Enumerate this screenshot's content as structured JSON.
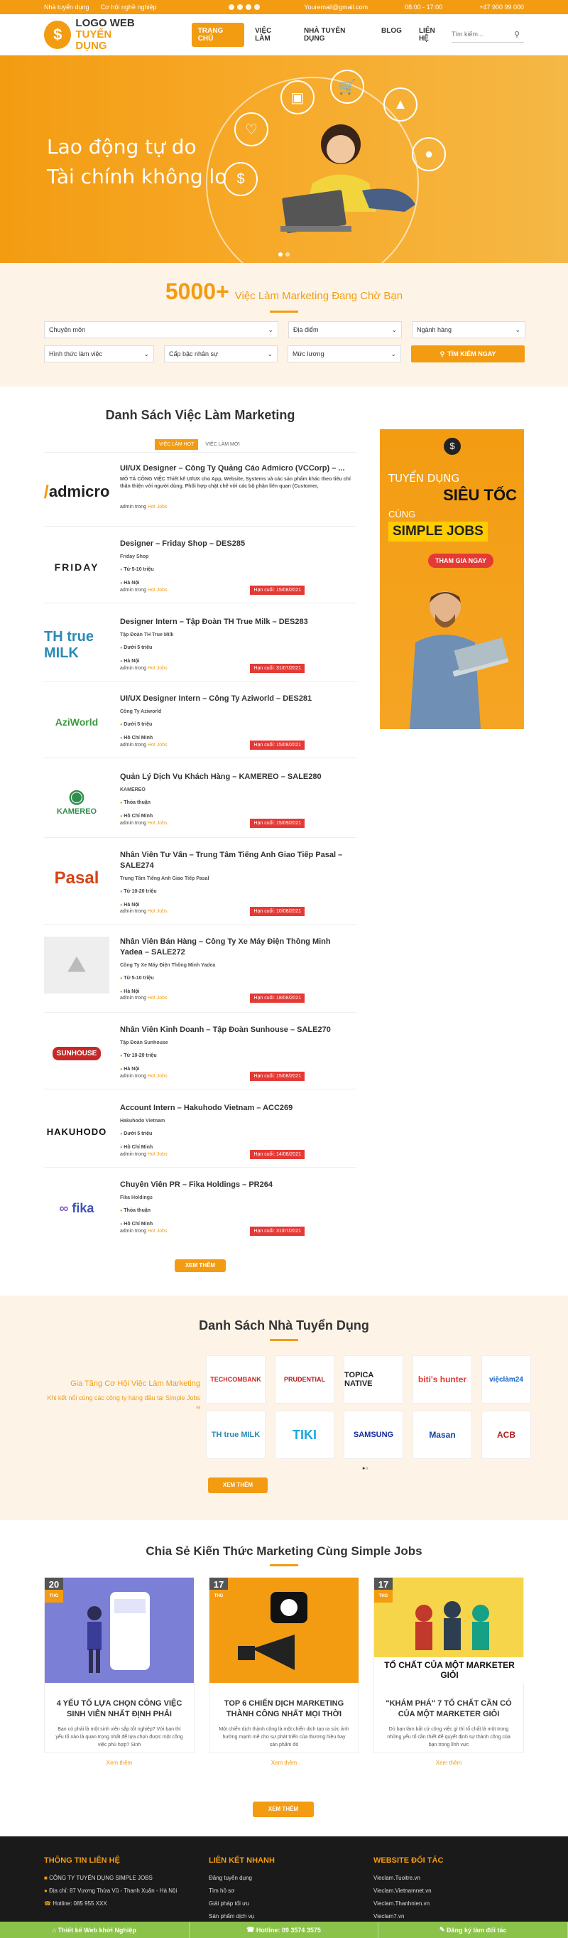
{
  "topbar": {
    "link1": "Nhà tuyển dụng",
    "link2": "Cơ hội nghề nghiệp",
    "email": "Youremail@gmail.com",
    "hours": "08:00 - 17:00",
    "phone": "+47 900 99 000"
  },
  "header": {
    "logo_line1": "LOGO WEB",
    "logo_line2": "TUYỂN DỤNG",
    "nav": [
      "TRANG CHỦ",
      "VIỆC LÀM",
      "NHÀ TUYỂN DỤNG",
      "BLOG",
      "LIÊN HỆ"
    ],
    "search_placeholder": "Tìm kiếm..."
  },
  "hero": {
    "line1": "Lao động tự do",
    "line2": "Tài chính không lo"
  },
  "search": {
    "count": "5000+",
    "headline": "Việc Làm Marketing Đang Chờ Bạn",
    "f1": "Chuyên môn",
    "f2": "Địa điểm",
    "f3": "Ngành hàng",
    "f4": "Hình thức làm việc",
    "f5": "Cấp bậc nhân sự",
    "f6": "Mức lương",
    "button": "TÌM KIẾM NGAY"
  },
  "jobs": {
    "title": "Danh Sách Việc Làm Marketing",
    "tab_hot": "VIỆC LÀM HOT",
    "tab_new": "VIỆC LÀM MỚI",
    "by": "admin",
    "in": "trong",
    "cat": "Hot Jobs",
    "more": "XEM THÊM",
    "items": [
      {
        "logo": "admicro",
        "title": "UI/UX Designer – Công Ty Quảng Cáo Admicro (VCCorp) – ...",
        "desc": "MÔ TẢ CÔNG VIỆC Thiết kế UI/UX cho App, Website, Systems và các sản phẩm khác theo tiêu chí thân thiện với người dùng. Phối hợp chặt chẽ với các bộ phận liên quan (Customer,",
        "deadline": ""
      },
      {
        "logo": "FRIDAY",
        "title": "Designer – Friday Shop – DES285",
        "company": "Friday Shop",
        "salary": "Từ 5-10 triệu",
        "place": "Hà Nội",
        "deadline": "Hạn cuối: 15/08/2021"
      },
      {
        "logo": "TH true MILK",
        "title": "Designer Intern – Tập Đoàn TH True Milk – DES283",
        "company": "Tập Đoàn TH True Milk",
        "salary": "Dưới 5 triệu",
        "place": "Hà Nội",
        "deadline": "Hạn cuối: 31/07/2021"
      },
      {
        "logo": "AziWorld",
        "title": "UI/UX Designer Intern – Công Ty Aziworld – DES281",
        "company": "Công Ty Aziworld",
        "salary": "Dưới 5 triệu",
        "place": "Hồ Chí Minh",
        "deadline": "Hạn cuối: 15/08/2021"
      },
      {
        "logo": "KAMEREO",
        "title": "Quản Lý Dịch Vụ Khách Hàng – KAMEREO – SALE280",
        "company": "KAMEREO",
        "salary": "Thỏa thuận",
        "place": "Hồ Chí Minh",
        "deadline": "Hạn cuối: 15/09/2021"
      },
      {
        "logo": "Pasal",
        "title": "Nhân Viên Tư Vấn – Trung Tâm Tiếng Anh Giao Tiếp Pasal – SALE274",
        "company": "Trung Tâm Tiếng Anh Giao Tiếp Pasal",
        "salary": "Từ 10-20 triệu",
        "place": "Hà Nội",
        "deadline": "Hạn cuối: 10/08/2021"
      },
      {
        "logo": "",
        "title": "Nhân Viên Bán Hàng – Công Ty Xe Máy Điện Thông Minh Yadea – SALE272",
        "company": "Công Ty Xe Máy Điện Thông Minh Yadea",
        "salary": "Từ 5-10 triệu",
        "place": "Hà Nội",
        "deadline": "Hạn cuối: 18/08/2021"
      },
      {
        "logo": "SUNHOUSE",
        "title": "Nhân Viên Kinh Doanh – Tập Đoàn Sunhouse – SALE270",
        "company": "Tập Đoàn Sunhouse",
        "salary": "Từ 10-20 triệu",
        "place": "Hà Nội",
        "deadline": "Hạn cuối: 15/08/2021"
      },
      {
        "logo": "HAKUHODO",
        "title": "Account Intern – Hakuhodo Vietnam – ACC269",
        "company": "Hakuhodo Vietnam",
        "salary": "Dưới 5 triệu",
        "place": "Hồ Chí Minh",
        "deadline": "Hạn cuối: 14/08/2021"
      },
      {
        "logo": "fika",
        "title": "Chuyên Viên PR – Fika Holdings – PR264",
        "company": "Fika Holdings",
        "salary": "Thỏa thuận",
        "place": "Hồ Chí Minh",
        "deadline": "Hạn cuối: 31/07/2021"
      }
    ]
  },
  "ad": {
    "l1": "TUYỂN DỤNG",
    "l2": "SIÊU TỐC",
    "l3": "CÙNG",
    "l4": "SIMPLE JOBS",
    "cta": "THAM GIA NGAY"
  },
  "employers": {
    "title": "Danh Sách Nhà Tuyển Dụng",
    "left1": "Gia Tăng Cơ Hội Việc Làm Marketing",
    "left2": "Khi kết nối cùng các công ty hàng đầu tại Simple Jobs",
    "logos": [
      "TECHCOMBANK",
      "PRUDENTIAL",
      "TOPICA NATIVE",
      "biti's hunter",
      "việclàm24",
      "TH true MILK",
      "TIKI",
      "SAMSUNG",
      "Masan",
      "ACB"
    ],
    "more": "XEM THÊM"
  },
  "blog": {
    "title": "Chia Sẻ Kiến Thức Marketing Cùng Simple Jobs",
    "more": "XEM THÊM",
    "readmore": "Xem thêm",
    "posts": [
      {
        "day": "20",
        "mon": "THG",
        "title": "4 YẾU TỐ LỰA CHỌN CÔNG VIỆC SINH VIÊN NHẤT ĐỊNH PHẢI",
        "desc": "Bạn có phải là một sinh viên sắp tốt nghiệp? Với bạn thì yếu tố nào là quan trọng nhất để lựa chọn được một công việc phù hợp? Sinh"
      },
      {
        "day": "17",
        "mon": "THG",
        "title": "TOP 6 CHIẾN DỊCH MARKETING THÀNH CÔNG NHẤT MỌI THỜI",
        "desc": "Một chiến dịch thành công là một chiến dịch tạo ra sức ảnh hưởng mạnh mẽ cho sự phát triển của thương hiệu hay sản phẩm đó"
      },
      {
        "day": "17",
        "mon": "THG",
        "title": "\"KHÁM PHÁ\" 7 TỐ CHẤT CẦN CÓ CỦA MỘT MARKETER GIỎI",
        "desc": "Dù bạn làm bất cứ công việc gì thì tố chất là một trong những yếu tố cần thiết để quyết định sự thành công của bạn trong lĩnh vực",
        "banner": "TỐ CHẤT CỦA MỘT MARKETER GIỎI"
      }
    ]
  },
  "footer": {
    "c1_title": "THÔNG TIN LIÊN HỆ",
    "c1": [
      "CÔNG TY TUYỂN DỤNG SIMPLE JOBS",
      "Địa chỉ: 87 Vương Thừa Vũ - Thanh Xuân - Hà Nội",
      "Hotline: 085 955 XXX"
    ],
    "c2_title": "LIÊN KẾT NHANH",
    "c2": [
      "Đăng tuyển dụng",
      "Tìm hồ sơ",
      "Giải pháp tối ưu",
      "Sản phẩm dịch vụ"
    ],
    "c3_title": "WEBSITE ĐỐI TÁC",
    "c3": [
      "Vieclam.Tuoitre.vn",
      "Vieclam.Vietnamnet.vn",
      "Vieclam.Thanhnien.vn",
      "Vieclam7.vn"
    ],
    "bar1": "Thiết kế Web khởi Nghiệp",
    "bar2": "Hotline: 09 3574 3575",
    "bar3": "Đăng ký làm đối tác"
  },
  "colors": {
    "accent": "#f39c12",
    "deadline": "#e53935",
    "footer_bar": "#8bc34a"
  }
}
